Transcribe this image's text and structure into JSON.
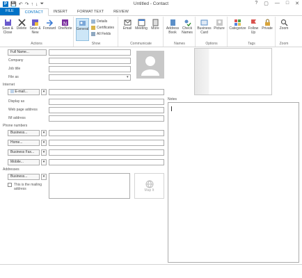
{
  "window": {
    "title": "Untitled - Contact"
  },
  "qat": {
    "app": "P",
    "save": "💾",
    "undo": "↶",
    "redo": "↷",
    "up": "↑",
    "down": "↓",
    "customize": "⏷"
  },
  "winctl": {
    "help": "?",
    "restore": "▢",
    "minimize": "—",
    "maximize": "□",
    "close": "✕"
  },
  "tabs": [
    "FILE",
    "CONTACT",
    "INSERT",
    "FORMAT TEXT",
    "REVIEW"
  ],
  "ribbon": {
    "actions": {
      "label": "Actions",
      "save_close": "Save & Close",
      "delete": "Delete",
      "save_new": "Save & New",
      "forward": "Forward",
      "onenote": "OneNote"
    },
    "show": {
      "label": "Show",
      "general": "General",
      "details": "Details",
      "certificates": "Certificates",
      "all_fields": "All Fields"
    },
    "communicate": {
      "label": "Communicate",
      "email": "Email",
      "meeting": "Meeting",
      "more": "More"
    },
    "names": {
      "label": "Names",
      "address_book": "Address Book",
      "check_names": "Check Names"
    },
    "options": {
      "label": "Options",
      "business_card": "Business Card",
      "picture": "Picture"
    },
    "tags": {
      "label": "Tags",
      "categorize": "Categorize",
      "follow_up": "Follow Up",
      "private": "Private"
    },
    "zoom": {
      "label": "Zoom",
      "zoom": "Zoom"
    }
  },
  "form": {
    "full_name": "Full Name...",
    "company": "Company",
    "job_title": "Job title",
    "file_as": "File as",
    "internet": "Internet",
    "email": "E-mail...",
    "display_as": "Display as",
    "web_page": "Web page address",
    "im_address": "IM address",
    "phone_numbers": "Phone numbers",
    "phone1": "Business...",
    "phone2": "Home...",
    "phone3": "Business Fax...",
    "phone4": "Mobile...",
    "addresses": "Addresses",
    "address_type": "Business...",
    "mailing_label": "This is the mailing address",
    "map_label": "Map It",
    "notes": "Notes",
    "dropdown_arrow": "▾"
  },
  "colors": {
    "accent": "#0072c6",
    "selected": "#cde6f7"
  }
}
